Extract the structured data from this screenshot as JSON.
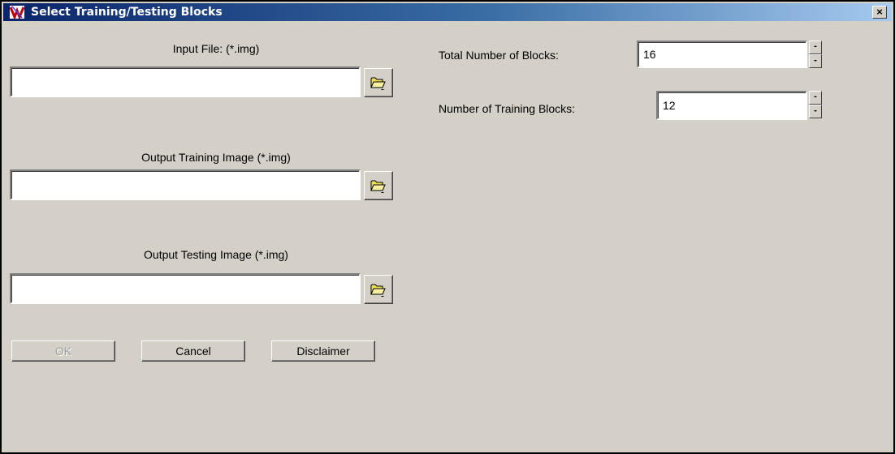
{
  "window": {
    "title": "Select Training/Testing Blocks",
    "close_glyph": "×"
  },
  "input_file": {
    "label": "Input File: (*.img)",
    "value": "",
    "browse_icon": "folder-open-icon"
  },
  "output_training": {
    "label": "Output Training Image (*.img)",
    "value": "",
    "browse_icon": "folder-open-icon"
  },
  "output_testing": {
    "label": "Output Testing Image (*.img)",
    "value": "",
    "browse_icon": "folder-open-icon"
  },
  "total_blocks": {
    "label": "Total Number of Blocks:",
    "value": "16"
  },
  "training_blocks": {
    "label": "Number of Training Blocks:",
    "value": "12"
  },
  "buttons": {
    "ok": "OK",
    "cancel": "Cancel",
    "disclaimer": "Disclaimer"
  },
  "colors": {
    "titlebar_start": "#0a246a",
    "titlebar_end": "#a6caf0",
    "dialog_bg": "#d4d0c8",
    "folder_yellow": "#f0e060"
  }
}
